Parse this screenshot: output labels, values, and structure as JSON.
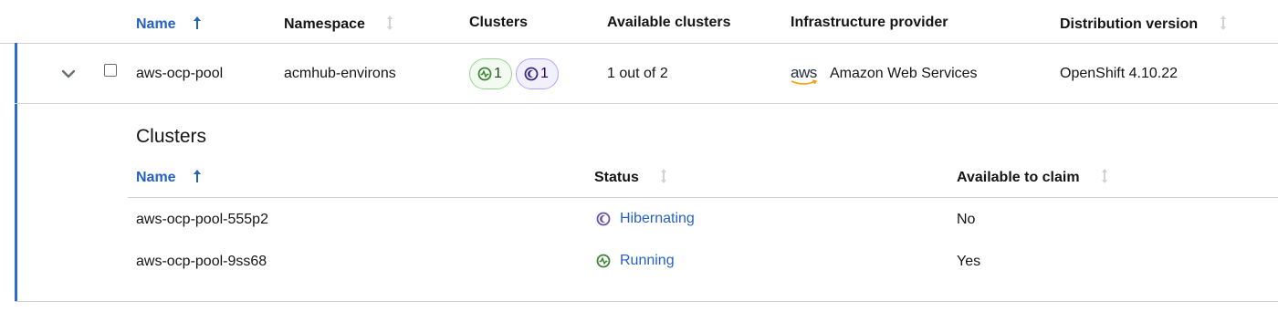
{
  "header": {
    "name": "Name",
    "namespace": "Namespace",
    "clusters": "Clusters",
    "available_clusters": "Available clusters",
    "infra_provider": "Infrastructure provider",
    "distribution_version": "Distribution version"
  },
  "row": {
    "name": "aws-ocp-pool",
    "namespace": "acmhub-environs",
    "running_count": "1",
    "hibernating_count": "1",
    "available": "1 out of 2",
    "provider_logo_text": "aws",
    "provider": "Amazon Web Services",
    "distribution": "OpenShift 4.10.22"
  },
  "expanded": {
    "title": "Clusters",
    "columns": {
      "name": "Name",
      "status": "Status",
      "available": "Available to claim"
    },
    "rows": [
      {
        "name": "aws-ocp-pool-555p2",
        "status": "Hibernating",
        "status_icon": "hibernating-icon",
        "available": "No"
      },
      {
        "name": "aws-ocp-pool-9ss68",
        "status": "Running",
        "status_icon": "running-icon",
        "available": "Yes"
      }
    ]
  },
  "colors": {
    "link_blue": "#2561c4",
    "accent_blue": "#2b6cd1",
    "running_green": "#3e8635",
    "hibernating_purple": "#6753ac"
  }
}
